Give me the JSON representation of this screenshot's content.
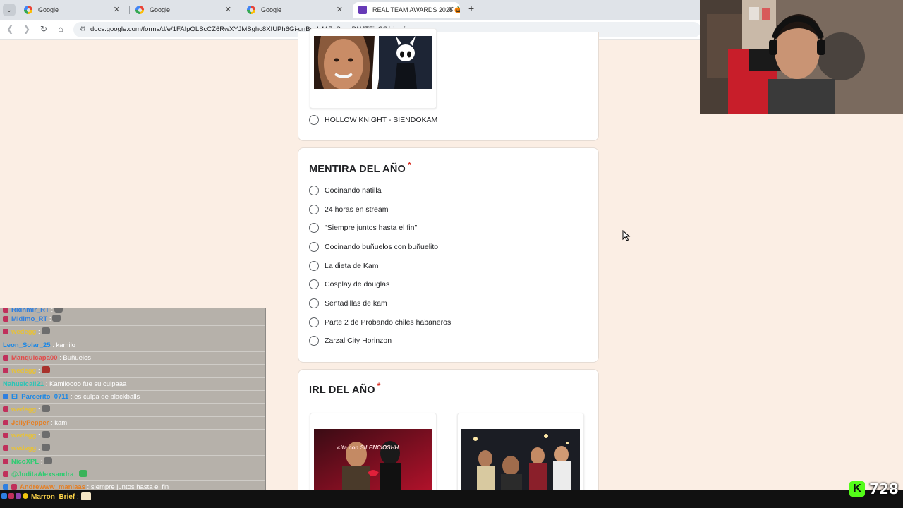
{
  "browser": {
    "tabs": [
      {
        "title": "Google",
        "close": "✕"
      },
      {
        "title": "Google",
        "close": "✕"
      },
      {
        "title": "Google",
        "close": "✕"
      },
      {
        "title": "REAL TEAM AWARDS 2025 🎃",
        "close": "✕"
      }
    ],
    "new_tab": "+",
    "tab_menu": "⌄",
    "url": "docs.google.com/forms/d/e/1FAIpQLScCZ6RwXYJMSghc8XIUPh6Gi-unBpzk4A7uSnohDNJTFicCQ/viewform"
  },
  "form": {
    "prev_question": {
      "option_label": "HOLLOW KNIGHT - SIENDOKAM"
    },
    "mentira": {
      "title": "MENTIRA DEL AÑO",
      "required_mark": "*",
      "options": [
        "Cocinando natilla",
        "24 horas en stream",
        "\"Siempre juntos hasta el fin\"",
        "Cocinando buñuelos con buñuelito",
        "La dieta de Kam",
        "Cosplay de douglas",
        "Sentadillas de kam",
        "Parte 2 de Probando chiles habaneros",
        "Zarzal City Horinzon"
      ]
    },
    "irl": {
      "title": "IRL DEL AÑO",
      "required_mark": "*",
      "thumb1_caption": "cita con SILENCIOSHH"
    }
  },
  "chat": {
    "messages": [
      {
        "user": "Ridhmir_RT",
        "sep": " :",
        "text": "",
        "color": "#2f7fe0",
        "emote": "gray"
      },
      {
        "user": "Midimo_RT",
        "sep": " :",
        "text": "",
        "color": "#2f7fe0",
        "emote": "gray"
      },
      {
        "user": "wedegg",
        "sep": " :",
        "text": "",
        "color": "#e6c13a",
        "emote": "gray"
      },
      {
        "user": "Leon_Solar_25",
        "sep": " :",
        "text": "kamilo",
        "color": "#1e88e5",
        "emote": ""
      },
      {
        "user": "Manquicapa00",
        "sep": " :",
        "text": "Buñuelos",
        "color": "#e24a4a",
        "emote": ""
      },
      {
        "user": "wedegg",
        "sep": " :",
        "text": "",
        "color": "#e6c13a",
        "emote": "red"
      },
      {
        "user": "Nahuelcali21",
        "sep": " :",
        "text": "Kamiloooo fue su culpaaa",
        "color": "#2ec4b6",
        "emote": ""
      },
      {
        "user": "El_Parcerito_0711",
        "sep": " :",
        "text": "es culpa de blackballs",
        "color": "#1e88e5",
        "emote": ""
      },
      {
        "user": "wedegg",
        "sep": " :",
        "text": "",
        "color": "#e6c13a",
        "emote": "gray"
      },
      {
        "user": "JellyPepper",
        "sep": " :",
        "text": "kam",
        "color": "#e67e22",
        "emote": ""
      },
      {
        "user": "wedegg",
        "sep": " :",
        "text": "",
        "color": "#e6c13a",
        "emote": "gray"
      },
      {
        "user": "wedegg",
        "sep": " :",
        "text": "",
        "color": "#e6c13a",
        "emote": "gray"
      },
      {
        "user": "NicoXPL",
        "sep": " :",
        "text": "",
        "color": "#2ecc71",
        "emote": "gray"
      },
      {
        "user": "@JuditaAlexsandra",
        "sep": " :",
        "text": "",
        "color": "#2ecc71",
        "emote": "green"
      },
      {
        "user": "Andrewww_maniaas",
        "sep": " :",
        "text": "siempre juntos hasta el fin",
        "color": "#e67e22",
        "emote": ""
      }
    ],
    "last_user": "Marron_Brief",
    "last_sep": " :"
  },
  "stream": {
    "viewer_count": "728",
    "platform_glyph": "K"
  },
  "colors": {
    "form_background": "#fbeee4",
    "required": "#d93025",
    "kick_green": "#53fc18",
    "form_accent": "#673ab7"
  },
  "icons": [
    "back-icon",
    "forward-icon",
    "reload-icon",
    "home-icon",
    "site-settings-icon",
    "google-favicon",
    "forms-favicon",
    "radio-icon",
    "mouse-cursor-icon"
  ]
}
